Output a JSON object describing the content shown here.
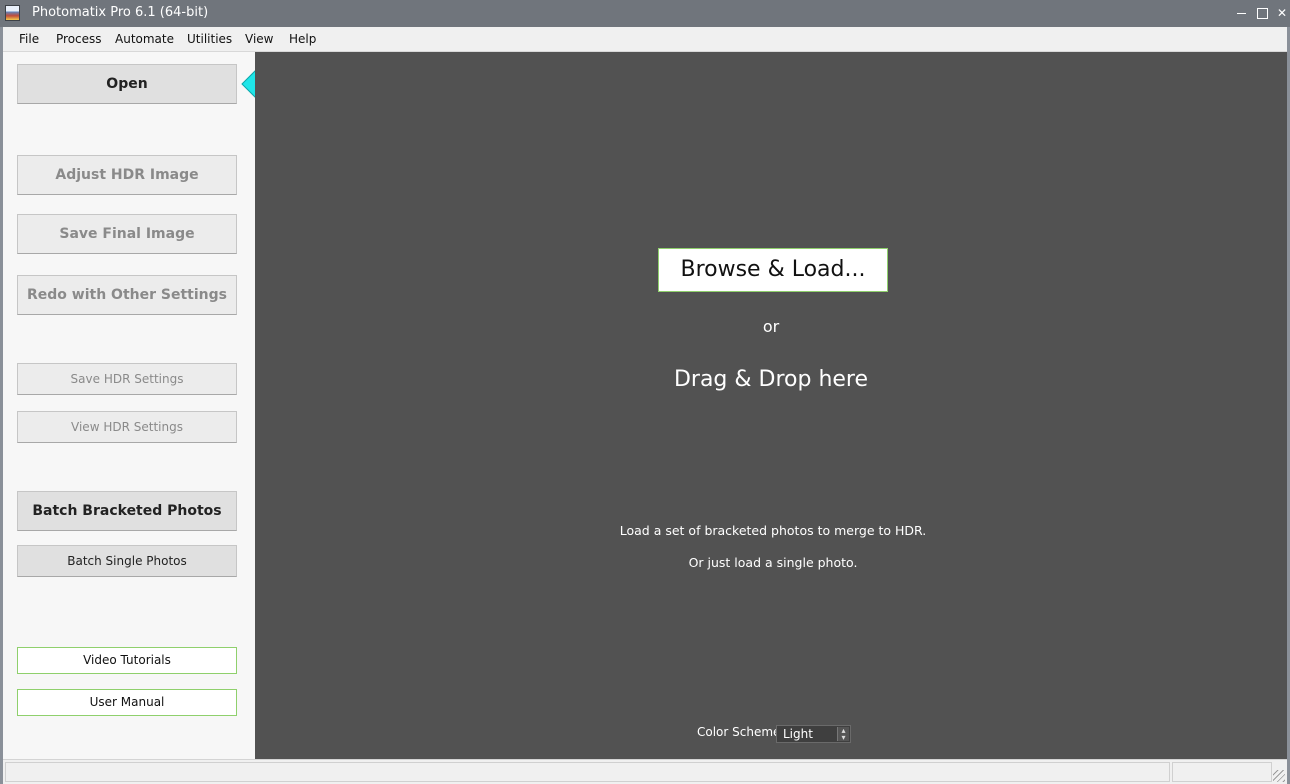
{
  "window": {
    "title": "Photomatix Pro 6.1 (64-bit)"
  },
  "menu": {
    "items": [
      "File",
      "Process",
      "Automate",
      "Utilities",
      "View",
      "Help"
    ]
  },
  "sidebar": {
    "open_label": "Open",
    "adjust_label": "Adjust HDR Image",
    "save_final_label": "Save Final Image",
    "redo_label": "Redo with Other Settings",
    "save_hdr_settings_label": "Save HDR Settings",
    "view_hdr_settings_label": "View HDR Settings",
    "batch_bracketed_label": "Batch Bracketed Photos",
    "batch_single_label": "Batch Single Photos",
    "video_tutorials_label": "Video Tutorials",
    "user_manual_label": "User Manual"
  },
  "main": {
    "browse_label": "Browse & Load...",
    "or_text": "or",
    "drag_text": "Drag & Drop here",
    "hint_line1": "Load a set of bracketed photos to merge to HDR.",
    "hint_line2": "Or just load a single photo.",
    "color_scheme_label": "Color Scheme:",
    "color_scheme_value": "Light"
  },
  "colors": {
    "title_bar": "#70757c",
    "main_bg": "#525252",
    "accent_green": "#8fd06c",
    "arrow_cyan": "#1fe5e8"
  },
  "icons": [
    "app-icon",
    "minimize-icon",
    "maximize-icon",
    "close-icon",
    "left-arrow-icon",
    "select-chevron-icon",
    "resize-grip-icon"
  ]
}
